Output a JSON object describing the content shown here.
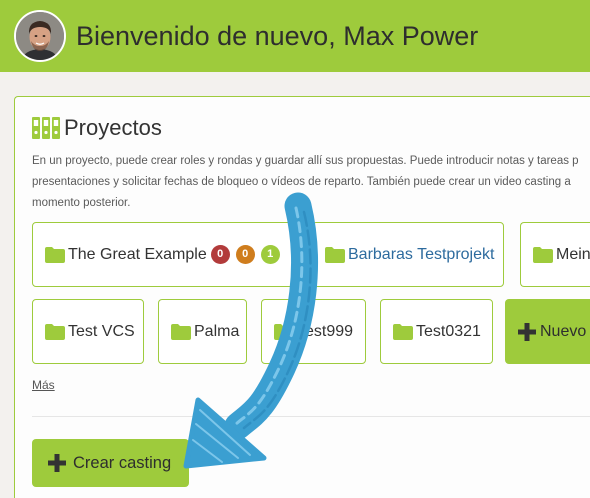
{
  "header": {
    "title": "Bienvenido de nuevo, Max Power",
    "avatar_icon": "user-photo"
  },
  "projects": {
    "icon": "binders-icon",
    "heading": "Proyectos",
    "intro_lines": [
      "En un proyecto, puede crear roles y rondas y guardar allí sus propuestas. Puede introducir notas y tareas p",
      "presentaciones y solicitar fechas de bloqueo o vídeos de reparto. También puede crear un video casting a",
      "momento posterior."
    ],
    "cards": [
      {
        "label": "The Great Example",
        "icon": "folder-icon",
        "badges": [
          {
            "value": "0",
            "color": "#b23b3b"
          },
          {
            "value": "0",
            "color": "#cf7d1d"
          },
          {
            "value": "1",
            "color": "#9ecb3c"
          }
        ]
      },
      {
        "label": "Barbaras Testprojekt",
        "icon": "folder-icon",
        "color": "#2d6b9e"
      },
      {
        "label": "Mein",
        "icon": "folder-icon"
      },
      {
        "label": "Test VCS",
        "icon": "folder-icon"
      },
      {
        "label": "Palma",
        "icon": "folder-icon"
      },
      {
        "label": "Test999",
        "icon": "folder-icon"
      },
      {
        "label": "Test0321",
        "icon": "folder-icon"
      }
    ],
    "new_button": {
      "label": "Nuevo",
      "icon": "plus-icon"
    },
    "more_link": "Más",
    "create_casting": {
      "label": "Crear casting",
      "icon": "plus-icon"
    }
  },
  "annotation": {
    "icon": "curved-arrow",
    "color": "#3b9fd1"
  },
  "colors": {
    "accent": "#9ecb3c",
    "background": "#f3f1ee",
    "text": "#333333",
    "link": "#2d6b9e"
  }
}
